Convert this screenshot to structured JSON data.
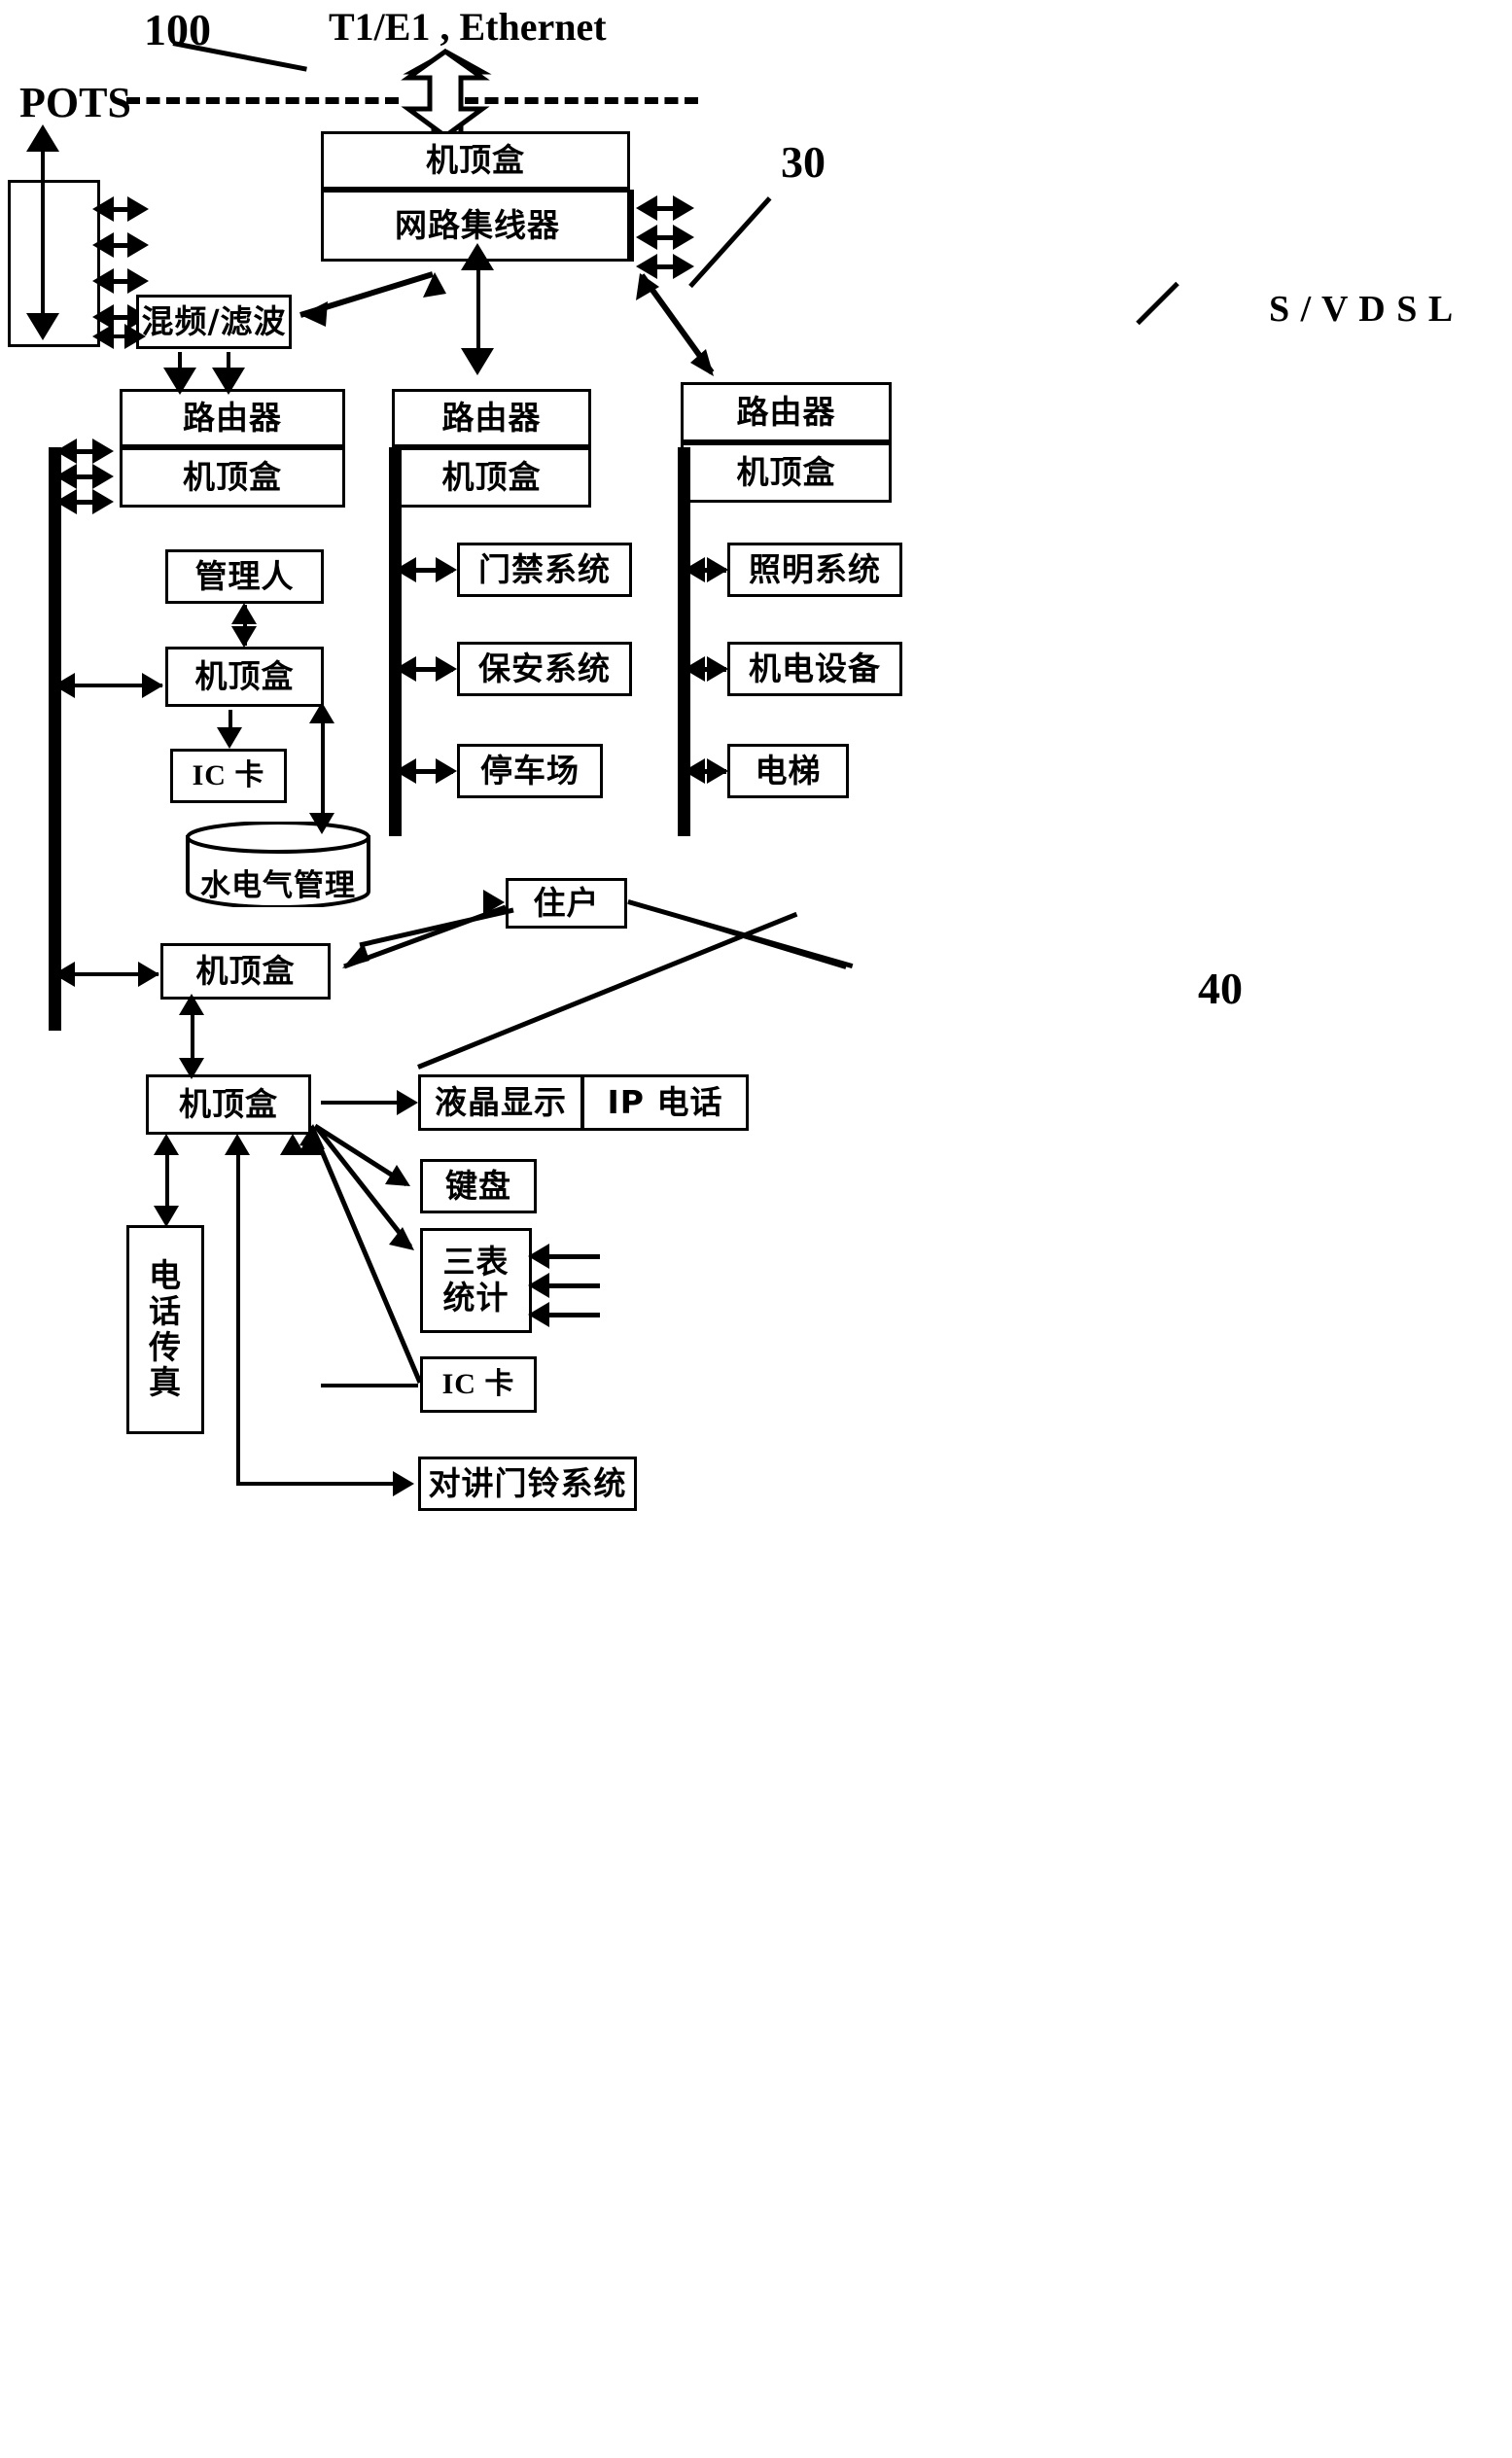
{
  "figure": {
    "ref_100": "100",
    "ref_30": "30",
    "ref_40": "40",
    "pots_label": "POTS",
    "uplink_label": "T1/E1 , Ethernet",
    "svdsl_label": "S / V D S L"
  },
  "nodes": {
    "head_stb": "机顶盒",
    "net_hub": "网路集线器",
    "mixer_filter": "混频/滤波",
    "router_1": "路由器",
    "router_1_stb": "机顶盒",
    "router_2": "路由器",
    "router_2_stb": "机顶盒",
    "router_3": "路由器",
    "router_3_stb": "机顶盒",
    "manager": "管理人",
    "manager_stb": "机顶盒",
    "ic_card_mgr": "IC 卡",
    "utility_db": "水电气管理",
    "access_control": "门禁系统",
    "security_system": "保安系统",
    "parking_lot": "停车场",
    "lighting_system": "照明系统",
    "mech_elec_equip": "机电设备",
    "elevator": "电梯",
    "resident": "住户",
    "riser_stb": "机顶盒",
    "home_stb": "机顶盒",
    "lcd_display": "液晶显示",
    "ip_phone": "IP 电话",
    "keyboard": "键盘",
    "three_meter_stats": "三表\n统计",
    "three_meter_l1": "三表",
    "three_meter_l2": "统计",
    "ic_card_home": "IC 卡",
    "phone_fax_l1": "电",
    "phone_fax_l2": "话",
    "phone_fax_l3": "传",
    "phone_fax_l4": "真",
    "intercom_doorbell": "对讲门铃系统"
  },
  "colors": {
    "ink": "#000000",
    "paper": "#ffffff"
  }
}
